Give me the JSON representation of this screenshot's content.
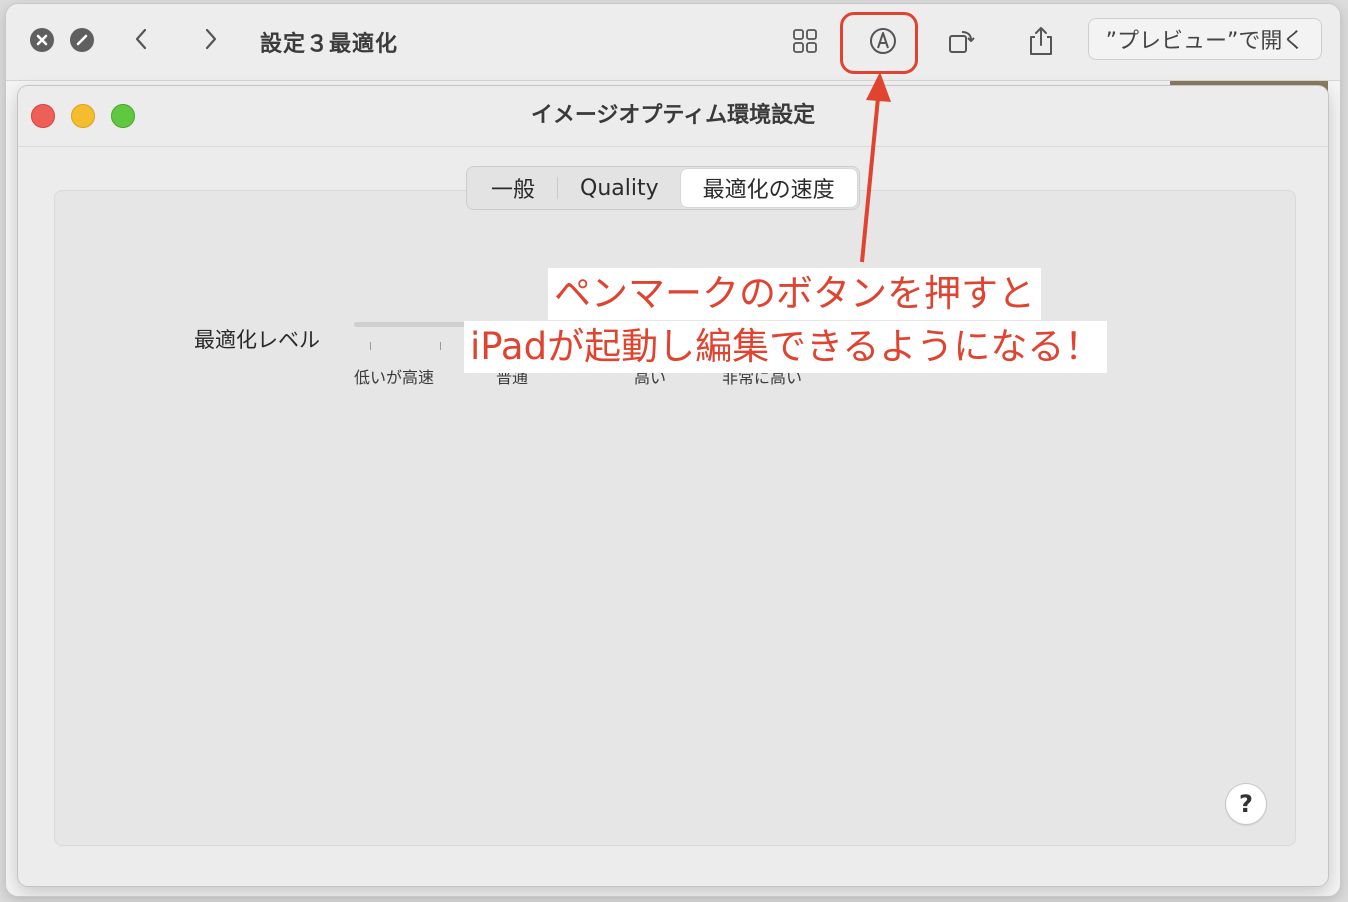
{
  "quicklook": {
    "title": "設定３最適化",
    "open_button_label": "”プレビュー”で開く"
  },
  "prefs": {
    "window_title": "イメージオプティム環境設定",
    "tabs": [
      {
        "label": "一般",
        "active": false
      },
      {
        "label": "Quality",
        "active": false
      },
      {
        "label": "最適化の速度",
        "active": true
      }
    ],
    "level_label": "最適化レベル",
    "tick_labels": [
      "低いが高速",
      "普通",
      "高い",
      "非常に高い"
    ],
    "help_label": "?"
  },
  "annotation": {
    "line1": "ペンマークのボタンを押すと",
    "line2": "iPadが起動し編集できるようになる！",
    "color": "#e0432f"
  },
  "icons": [
    "close-circle-icon",
    "block-icon",
    "chevron-left-icon",
    "chevron-right-icon",
    "grid-icon",
    "markup-pen-icon",
    "rotate-icon",
    "share-icon"
  ]
}
